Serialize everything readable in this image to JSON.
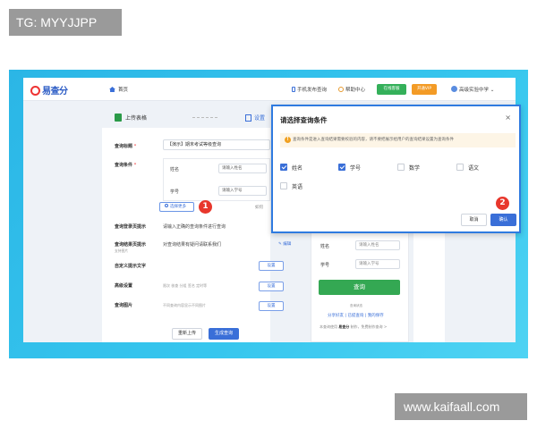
{
  "watermarks": {
    "top_left": "TG: MYYJJPP",
    "bottom_right": "www.kaifaall.com"
  },
  "topbar": {
    "home": "首页",
    "mobile_publish": "手机发布查询",
    "help_center": "帮助中心",
    "online_customer_service": "在线客服",
    "open_vip": "开通VIP",
    "school": "高级实验中学"
  },
  "steps": {
    "step1": "上传表格",
    "step2": "设置"
  },
  "form": {
    "query_title_label": "查询标题",
    "query_title_value": "【演示】期末考试等级查询",
    "query_condition_label": "查询条件",
    "conditions": [
      {
        "label": "姓名",
        "placeholder": "请输入姓名"
      },
      {
        "label": "学号",
        "placeholder": "请输入学号"
      }
    ],
    "select_more": "选择更多",
    "how_to": "如何",
    "login_tip_label": "查询登录页提示",
    "login_tip_value": "请输入正确的查询条件进行查询",
    "result_tip_label": "查询结果页提示",
    "result_tip_sub": "支持图片",
    "result_tip_value": "对查询结果有疑问请联系我们",
    "edit": "编辑",
    "custom_text_label": "自定义提示文字",
    "advanced_label": "高级设置",
    "advanced_hint": "限次 核查 分组 签名 定时等",
    "query_image_label": "查询图片",
    "query_image_hint": "不同查询内容显示不同图片",
    "set": "设置",
    "reupload": "重新上传",
    "generate": "生成查询"
  },
  "preview": {
    "name_label": "姓名",
    "name_placeholder": "请输入姓名",
    "id_label": "学号",
    "id_placeholder": "请输入学号",
    "query_button": "查询",
    "footer1": "查询状态",
    "links": "分享好友 | 已提查询 | 我的保存",
    "footer2_prefix": "本查询使用",
    "footer2_brand": "易查分",
    "footer2_suffix": "制作，免费制作查询 >"
  },
  "modal": {
    "title": "请选择查询条件",
    "close": "×",
    "note": "查询条件是进入查询结果需要校验的内容，请不要把展示给用户的查询结果设置为查询条件",
    "options": [
      {
        "label": "姓名",
        "checked": true
      },
      {
        "label": "学号",
        "checked": true
      },
      {
        "label": "数学",
        "checked": false
      },
      {
        "label": "语文",
        "checked": false
      },
      {
        "label": "英语",
        "checked": false
      }
    ],
    "cancel": "取消",
    "confirm": "确认"
  },
  "badges": {
    "one": "1",
    "two": "2"
  }
}
